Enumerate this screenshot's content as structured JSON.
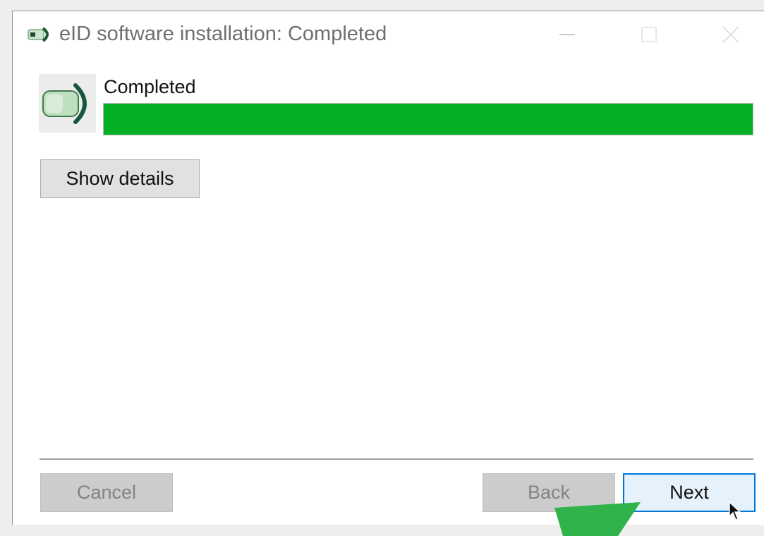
{
  "window": {
    "title": "eID software installation: Completed"
  },
  "status": {
    "label": "Completed",
    "progress_percent": 100,
    "progress_color": "#06b025"
  },
  "buttons": {
    "show_details": "Show details",
    "cancel": "Cancel",
    "back": "Back",
    "next": "Next"
  },
  "icons": {
    "app": "beid-logo-icon",
    "minimize": "minimize-icon",
    "maximize": "maximize-icon",
    "close": "close-icon",
    "cursor": "mouse-pointer-icon",
    "overlay": "green-arrow-icon"
  },
  "colors": {
    "accent": "#0078d7",
    "logo_green": "#1a8c4e"
  }
}
